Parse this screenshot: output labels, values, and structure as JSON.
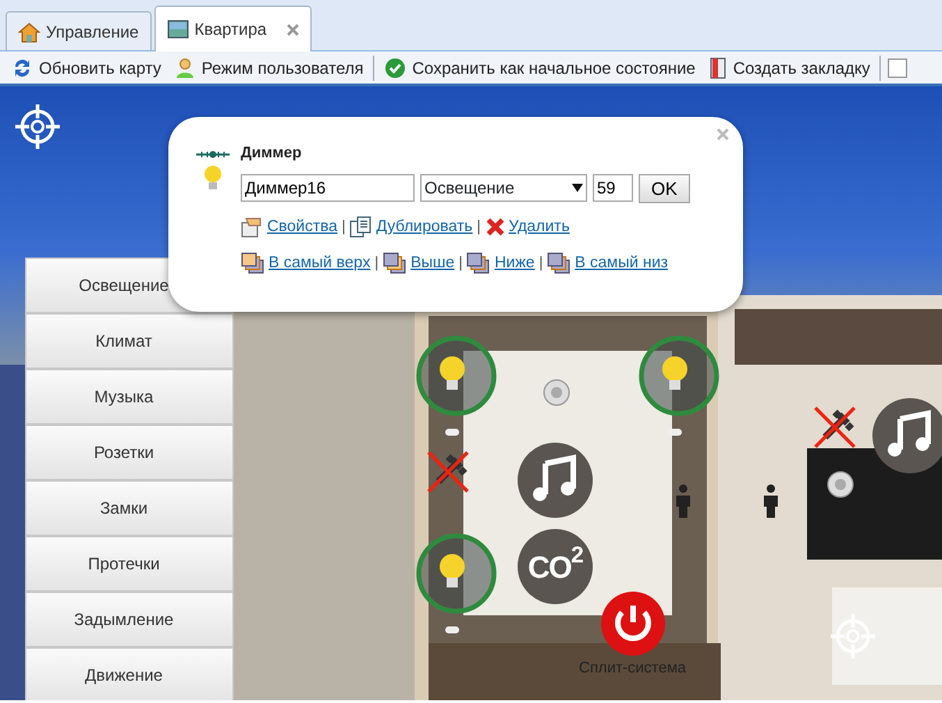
{
  "tabs": [
    {
      "label": "Управление",
      "selected": false,
      "closable": false
    },
    {
      "label": "Квартира",
      "selected": true,
      "closable": true
    }
  ],
  "toolbar": [
    {
      "kind": "button",
      "label": "Обновить карту"
    },
    {
      "kind": "button",
      "label": "Режим пользователя"
    },
    {
      "kind": "separator"
    },
    {
      "kind": "button",
      "label": "Сохранить как начальное состояние"
    },
    {
      "kind": "button",
      "label": "Создать закладку"
    },
    {
      "kind": "separator"
    },
    {
      "kind": "checkbox",
      "checked": false
    }
  ],
  "menu": [
    {
      "label": "Освещение"
    },
    {
      "label": "Климат"
    },
    {
      "label": "Музыка"
    },
    {
      "label": "Розетки"
    },
    {
      "label": "Замки"
    },
    {
      "label": "Протечки"
    },
    {
      "label": "Задымление"
    },
    {
      "label": "Движение"
    }
  ],
  "devices": [
    {
      "kind": "light",
      "on": true
    },
    {
      "kind": "light",
      "on": true
    },
    {
      "kind": "light",
      "on": true
    },
    {
      "kind": "socket",
      "on": false
    },
    {
      "kind": "socket",
      "on": false
    },
    {
      "kind": "music"
    },
    {
      "kind": "music"
    },
    {
      "kind": "co2",
      "label": "CO$^{2}$"
    },
    {
      "kind": "power",
      "label": "Сплит-система"
    },
    {
      "kind": "motion"
    },
    {
      "kind": "motion"
    },
    {
      "kind": "smoke"
    },
    {
      "kind": "smoke"
    },
    {
      "kind": "target"
    },
    {
      "kind": "target"
    }
  ],
  "popup": {
    "title": "Диммер",
    "name_value": "Диммер16",
    "category": "Освещение",
    "number_value": "59",
    "ok": "OK",
    "actions": [
      [
        {
          "kind": "link",
          "label": "Свойства"
        },
        {
          "kind": "separator",
          "label": "|"
        },
        {
          "kind": "link",
          "label": "Дублировать"
        },
        {
          "kind": "separator",
          "label": "|"
        },
        {
          "kind": "link",
          "label": "Удалить"
        }
      ],
      [
        {
          "kind": "link",
          "label": "В самый верх"
        },
        {
          "kind": "separator",
          "label": "|"
        },
        {
          "kind": "link",
          "label": "Выше"
        },
        {
          "kind": "separator",
          "label": "|"
        },
        {
          "kind": "link",
          "label": "Ниже"
        },
        {
          "kind": "separator",
          "label": "|"
        },
        {
          "kind": "link",
          "label": "В самый низ"
        }
      ]
    ]
  }
}
